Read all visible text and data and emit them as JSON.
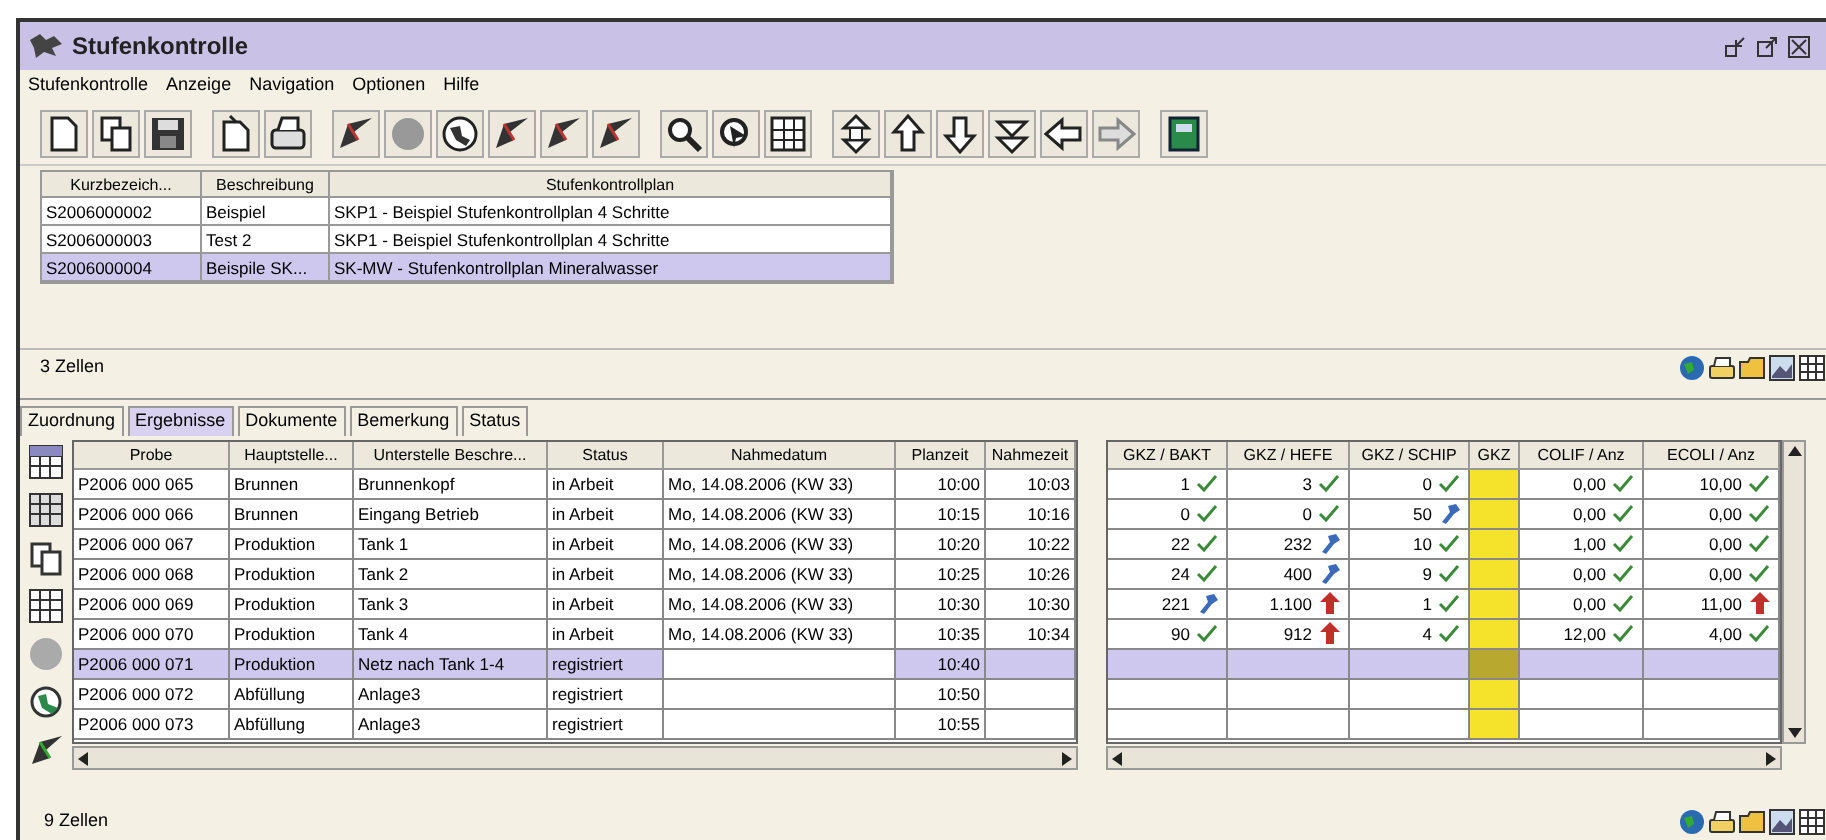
{
  "window": {
    "title": "Stufenkontrolle"
  },
  "menu": [
    "Stufenkontrolle",
    "Anzeige",
    "Navigation",
    "Optionen",
    "Hilfe"
  ],
  "plans": {
    "columns": [
      "Kurzbezeich...",
      "Beschreibung",
      "Stufenkontrollplan"
    ],
    "rows": [
      {
        "cells": [
          "S2006000002",
          "Beispiel",
          "SKP1 - Beispiel Stufenkontrollplan 4 Schritte"
        ],
        "selected": false
      },
      {
        "cells": [
          "S2006000003",
          "Test 2",
          "SKP1 - Beispiel Stufenkontrollplan 4 Schritte"
        ],
        "selected": false
      },
      {
        "cells": [
          "S2006000004",
          "Beispile SK...",
          "SK-MW - Stufenkontrollplan Mineralwasser"
        ],
        "selected": true
      }
    ],
    "status": "3 Zellen"
  },
  "tabs": [
    {
      "label": "Zuordnung",
      "selected": false
    },
    {
      "label": "Ergebnisse",
      "selected": true
    },
    {
      "label": "Dokumente",
      "selected": false
    },
    {
      "label": "Bemerkung",
      "selected": false
    },
    {
      "label": "Status",
      "selected": false
    }
  ],
  "samples": {
    "columns": [
      "Probe",
      "Hauptstelle...",
      "Unterstelle Beschre...",
      "Status",
      "Nahmedatum",
      "Planzeit",
      "Nahmezeit"
    ],
    "rows": [
      {
        "cells": [
          "P2006 000 065",
          "Brunnen",
          "Brunnenkopf",
          "in Arbeit",
          "Mo, 14.08.2006 (KW 33)",
          "10:00",
          "10:03"
        ],
        "selected": false
      },
      {
        "cells": [
          "P2006 000 066",
          "Brunnen",
          "Eingang Betrieb",
          "in Arbeit",
          "Mo, 14.08.2006 (KW 33)",
          "10:15",
          "10:16"
        ],
        "selected": false
      },
      {
        "cells": [
          "P2006 000 067",
          "Produktion",
          "Tank 1",
          "in Arbeit",
          "Mo, 14.08.2006 (KW 33)",
          "10:20",
          "10:22"
        ],
        "selected": false
      },
      {
        "cells": [
          "P2006 000 068",
          "Produktion",
          "Tank 2",
          "in Arbeit",
          "Mo, 14.08.2006 (KW 33)",
          "10:25",
          "10:26"
        ],
        "selected": false
      },
      {
        "cells": [
          "P2006 000 069",
          "Produktion",
          "Tank 3",
          "in Arbeit",
          "Mo, 14.08.2006 (KW 33)",
          "10:30",
          "10:30"
        ],
        "selected": false
      },
      {
        "cells": [
          "P2006 000 070",
          "Produktion",
          "Tank 4",
          "in Arbeit",
          "Mo, 14.08.2006 (KW 33)",
          "10:35",
          "10:34"
        ],
        "selected": false
      },
      {
        "cells": [
          "P2006 000 071",
          "Produktion",
          "Netz nach Tank 1-4",
          "registriert",
          "",
          "10:40",
          ""
        ],
        "selected": true
      },
      {
        "cells": [
          "P2006 000 072",
          "Abfüllung",
          "Anlage3",
          "registriert",
          "",
          "10:50",
          ""
        ],
        "selected": false
      },
      {
        "cells": [
          "P2006 000 073",
          "Abfüllung",
          "Anlage3",
          "registriert",
          "",
          "10:55",
          ""
        ],
        "selected": false
      }
    ]
  },
  "results": {
    "columns": [
      "GKZ / BAKT",
      "GKZ / HEFE",
      "GKZ / SCHIP",
      "GKZ",
      "COLIF / Anz",
      "ECOLI / Anz"
    ],
    "rows": [
      {
        "values": [
          {
            "value": "1",
            "kind": "ok"
          },
          {
            "value": "3",
            "kind": "ok"
          },
          {
            "value": "0",
            "kind": "ok"
          },
          {
            "value": "0,00",
            "kind": "ok"
          },
          {
            "value": "10,00",
            "kind": "ok"
          }
        ],
        "selected": false
      },
      {
        "values": [
          {
            "value": "0",
            "kind": "ok"
          },
          {
            "value": "0",
            "kind": "ok"
          },
          {
            "value": "50",
            "kind": "warning"
          },
          {
            "value": "0,00",
            "kind": "ok"
          },
          {
            "value": "0,00",
            "kind": "ok"
          }
        ],
        "selected": false
      },
      {
        "values": [
          {
            "value": "22",
            "kind": "ok"
          },
          {
            "value": "232",
            "kind": "warning"
          },
          {
            "value": "10",
            "kind": "ok"
          },
          {
            "value": "1,00",
            "kind": "ok"
          },
          {
            "value": "0,00",
            "kind": "ok"
          }
        ],
        "selected": false
      },
      {
        "values": [
          {
            "value": "24",
            "kind": "ok"
          },
          {
            "value": "400",
            "kind": "warning"
          },
          {
            "value": "9",
            "kind": "ok"
          },
          {
            "value": "0,00",
            "kind": "ok"
          },
          {
            "value": "0,00",
            "kind": "ok"
          }
        ],
        "selected": false
      },
      {
        "values": [
          {
            "value": "221",
            "kind": "warning"
          },
          {
            "value": "1.100",
            "kind": "alarm"
          },
          {
            "value": "1",
            "kind": "ok"
          },
          {
            "value": "0,00",
            "kind": "ok"
          },
          {
            "value": "11,00",
            "kind": "alarm"
          }
        ],
        "selected": false
      },
      {
        "values": [
          {
            "value": "90",
            "kind": "ok"
          },
          {
            "value": "912",
            "kind": "alarm"
          },
          {
            "value": "4",
            "kind": "ok"
          },
          {
            "value": "12,00",
            "kind": "ok"
          },
          {
            "value": "4,00",
            "kind": "ok"
          }
        ],
        "selected": false
      },
      {
        "selected": true
      },
      {
        "selected": false
      },
      {
        "selected": false
      }
    ]
  },
  "status": "9 Zellen"
}
